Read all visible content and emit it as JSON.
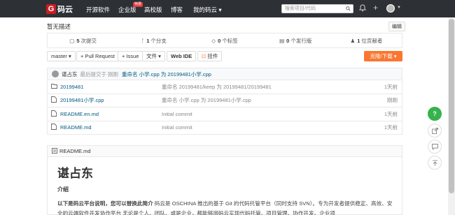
{
  "nav": {
    "logo": "码云",
    "items": [
      "开源软件",
      "企业版",
      "高校版",
      "博客",
      "我的码云 ▾"
    ],
    "badge": "特惠",
    "search_placeholder": "搜索项目/代码"
  },
  "repo": {
    "description": "暂无描述",
    "edit_label": "编辑",
    "stats": [
      {
        "count": "5",
        "label": "次提交"
      },
      {
        "count": "1",
        "label": "个分支"
      },
      {
        "count": "0",
        "label": "个标签"
      },
      {
        "count": "0",
        "label": "个发行版"
      },
      {
        "count": "1",
        "label": "位贡献者"
      }
    ]
  },
  "toolbar": {
    "branch": "master ▾",
    "pull_request": "+ Pull Request",
    "issue": "+ Issue",
    "file_menu": "文件 ▾",
    "web_ide": "Web IDE",
    "attachment": "挂件",
    "clone_download": "克隆/下载 ▾"
  },
  "commit": {
    "author": "谌占东",
    "text": "最后提交于",
    "time": "刚刚",
    "message": "重命名 小学.cpp 为 20199481小学.cpp"
  },
  "files": [
    {
      "icon": "folder-icon",
      "name": "20199481",
      "message": "重命名 20199481/keep 为 20199481/20199481",
      "time": "1天前"
    },
    {
      "icon": "file-icon",
      "name": "20199481小学.cpp",
      "message": "重命名 小学.cpp 为 20199481小学.cpp",
      "time": "刚刚"
    },
    {
      "icon": "file-icon",
      "name": "README.en.md",
      "message": "Initial commit",
      "time": "1天前"
    },
    {
      "icon": "file-icon",
      "name": "README.md",
      "message": "Initial commit",
      "time": "1天前"
    }
  ],
  "readme": {
    "file": "README.md",
    "title": "谌占东",
    "subtitle": "介绍",
    "para_bold": "以下是码云平台说明，您可以替换此简介",
    "para": " 码云是 OSCHINA 推出的基于 Git 的代码托管平台（同时支持 SVN）。专为开发者提供稳定、高效、安全的云端软件开发协作平台 无论是个人、团队、或是企业，都能够用码云实现代码托管、项目管理、协作开发。企业项"
  },
  "side": {
    "help": "?"
  }
}
